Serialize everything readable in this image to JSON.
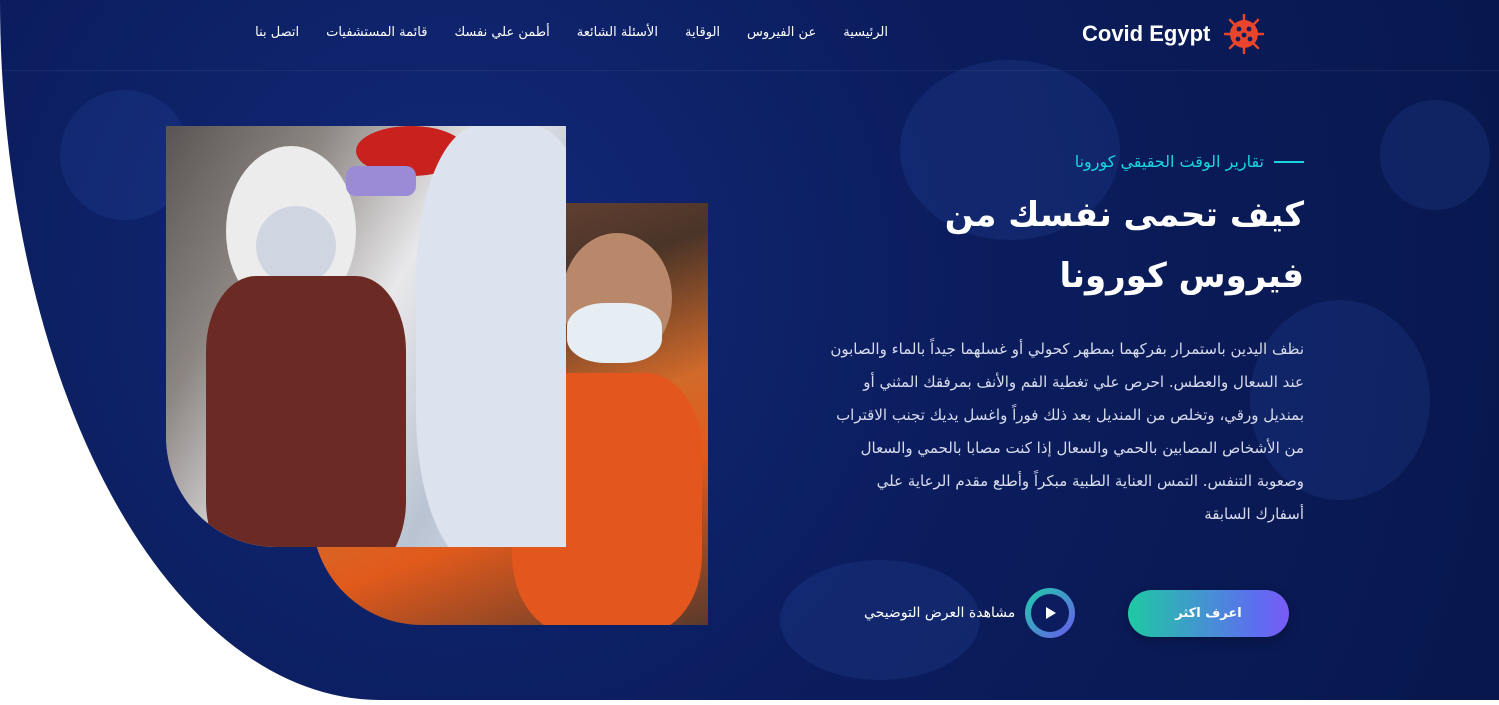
{
  "brand": {
    "name": "Covid Egypt",
    "icon": "virus-icon"
  },
  "nav": {
    "items": [
      {
        "label": "الرئيسية"
      },
      {
        "label": "عن الفيروس"
      },
      {
        "label": "الوقاية"
      },
      {
        "label": "الأسئلة الشائعة"
      },
      {
        "label": "أطمن علي نفسك"
      },
      {
        "label": "قائمة المستشفيات"
      },
      {
        "label": "اتصل بنا"
      }
    ]
  },
  "hero": {
    "kicker": "تقارير الوقت الحقيقي كورونا",
    "title": "كيف تحمى نفسك من فيروس كورونا",
    "description": "نظف اليدين باستمرار بفركهما بمطهر كحولي أو غسلهما جيداً بالماء والصابون عند السعال والعطس. احرص علي تغطية الفم والأنف بمرفقك المثني أو بمنديل ورقي، وتخلص من المنديل بعد ذلك فوراً واغسل يديك تجنب الاقتراب من الأشخاص المصابين بالحمي والسعال إذا كنت مصابا بالحمي والسعال وصعوبة التنفس. التمس العناية الطبية مبكراً وأطلع مقدم الرعاية علي أسفارك السابقة",
    "primary_button": "اعرف اكثر",
    "video_label": "مشاهدة العرض التوضيحي",
    "play_icon": "play-icon"
  },
  "colors": {
    "hero_bg": "#0b1d5e",
    "accent": "#19d7e0",
    "button_gradient_start": "#1fc9a3",
    "button_gradient_end": "#7a5af5",
    "brand_icon": "#e8452c"
  }
}
